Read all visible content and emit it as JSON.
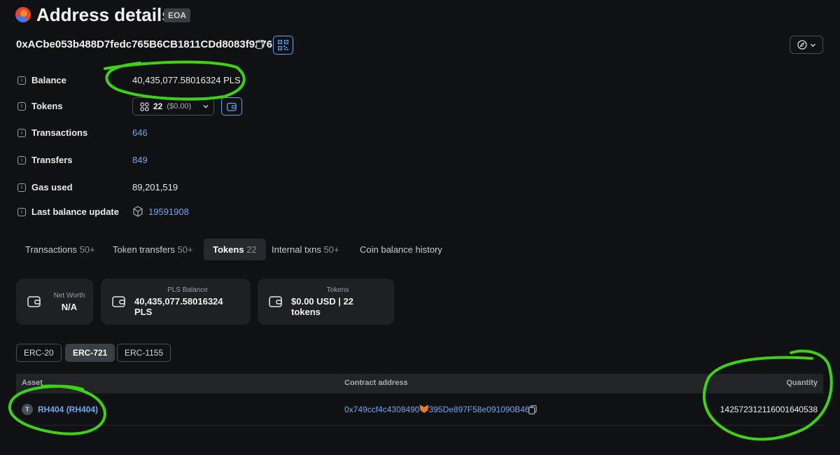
{
  "header": {
    "title": "Address details",
    "badge": "EOA",
    "address": "0xACbe053b488D7fedc765B6CB1811CDd8083f9276"
  },
  "details": {
    "balance_label": "Balance",
    "balance_value": "40,435,077.58016324 PLS",
    "tokens_label": "Tokens",
    "tokens_count": "22",
    "tokens_usd": "($0.00)",
    "transactions_label": "Transactions",
    "transactions_value": "646",
    "transfers_label": "Transfers",
    "transfers_value": "849",
    "gas_label": "Gas used",
    "gas_value": "89,201,519",
    "last_update_label": "Last balance update",
    "last_update_value": "19591908"
  },
  "tabs": [
    {
      "label": "Transactions",
      "count": "50+"
    },
    {
      "label": "Token transfers",
      "count": "50+"
    },
    {
      "label": "Tokens",
      "count": "22"
    },
    {
      "label": "Internal txns",
      "count": "50+"
    },
    {
      "label": "Coin balance history",
      "count": ""
    }
  ],
  "cards": [
    {
      "caption": "Net Worth",
      "value": "N/A"
    },
    {
      "caption": "PLS Balance",
      "value": "40,435,077.58016324 PLS"
    },
    {
      "caption": "Tokens",
      "value": "$0.00 USD | 22 tokens"
    }
  ],
  "filters": [
    "ERC-20",
    "ERC-721",
    "ERC-1155"
  ],
  "table": {
    "headers": {
      "asset": "Asset",
      "contract": "Contract address",
      "quantity": "Quantity"
    },
    "row": {
      "badge": "T",
      "asset": "RH404 (RH404)",
      "contract_start": "0x749ccf4c4308490",
      "contract_end": "395De897F58e091090B461",
      "quantity": "142572312116001640538"
    }
  },
  "colors": {
    "background": "#101112",
    "link": "#6fa8f0",
    "accent_border": "#63a2ef",
    "annotation": "#3ed312"
  }
}
